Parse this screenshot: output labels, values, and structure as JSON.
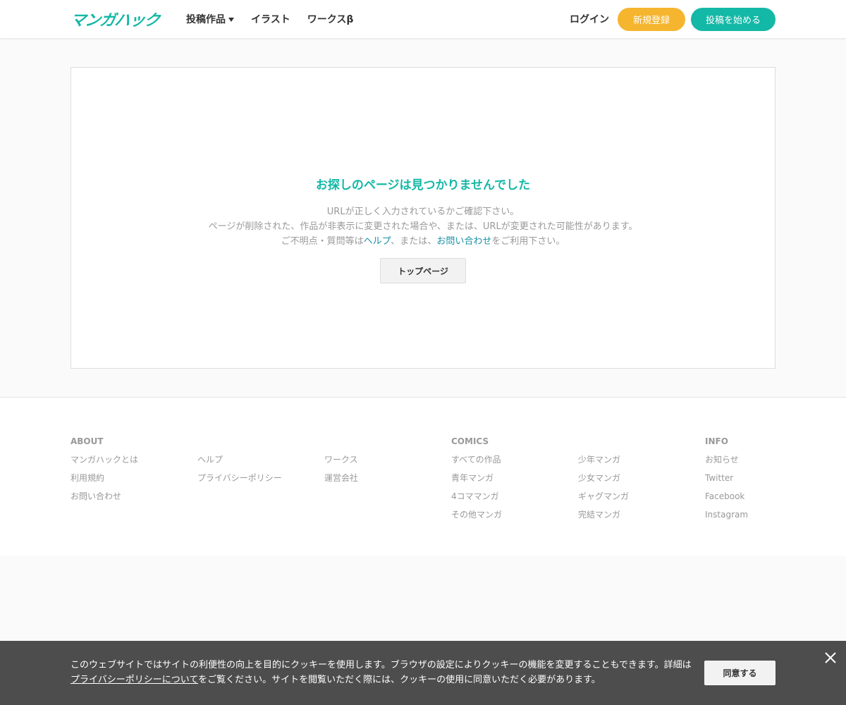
{
  "header": {
    "logo_text": "マンガハック",
    "nav": [
      {
        "label": "投稿作品",
        "has_dropdown": true
      },
      {
        "label": "イラスト"
      },
      {
        "label": "ワークスβ"
      }
    ],
    "login_label": "ログイン",
    "register_label": "新規登録",
    "post_label": "投稿を始める"
  },
  "error": {
    "title": "お探しのページは見つかりませんでした",
    "line1": "URLが正しく入力されているかご確認下さい。",
    "line2": "ページが削除された、作品が非表示に変更された場合や、または、URLが変更された可能性があります。",
    "line3_prefix": "ご不明点・質問等は",
    "help_link": "ヘルプ",
    "line3_middle": "、または、",
    "contact_link": "お問い合わせ",
    "line3_suffix": "をご利用下さい。",
    "top_button": "トップページ"
  },
  "footer": {
    "about": {
      "heading": "ABOUT",
      "col1": [
        "マンガハックとは",
        "利用規約",
        "お問い合わせ"
      ],
      "col2": [
        "ヘルプ",
        "プライバシーポリシー"
      ],
      "col3": [
        "ワークス",
        "運営会社"
      ]
    },
    "comics": {
      "heading": "COMICS",
      "col1": [
        "すべての作品",
        "青年マンガ",
        "4コママンガ",
        "その他マンガ"
      ],
      "col2": [
        "少年マンガ",
        "少女マンガ",
        "ギャグマンガ",
        "完結マンガ"
      ]
    },
    "info": {
      "heading": "INFO",
      "links": [
        "お知らせ",
        "Twitter",
        "Facebook",
        "Instagram"
      ]
    }
  },
  "cookie": {
    "text_part1": "このウェブサイトではサイトの利便性の向上を目的にクッキーを使用します。ブラウザの設定によりクッキーの機能を変更することもできます。詳細は",
    "policy_link": "プライバシーポリシーについて",
    "text_part2": "をご覧ください。サイトを閲覧いただく際には、クッキーの使用に同意いただく必要があります。",
    "agree_label": "同意する",
    "close_icon": "close-icon"
  },
  "colors": {
    "brand_teal": "#13b8a6",
    "accent_yellow": "#f5b52e",
    "link_blue": "#1a8fa6",
    "cookie_bg": "#4d4d4d"
  }
}
